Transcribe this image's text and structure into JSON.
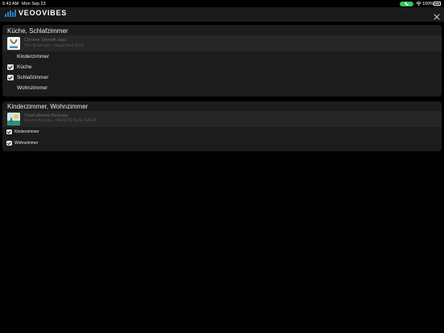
{
  "status_bar": {
    "time": "5:43 AM",
    "date": "Mon Sep 23",
    "battery_percent": "100%",
    "icons": [
      "phone-icon",
      "wifi-icon",
      "battery-icon"
    ]
  },
  "header": {
    "logo_text": "VEOOVIBES",
    "close_icon": "close-icon"
  },
  "colors": {
    "background": "#000000",
    "header": "#1a1a1a",
    "card": "#1c1c1c",
    "track_row": "#262626",
    "logo_accent": "#2d7fc4",
    "call_pill": "#34c759"
  },
  "groups": [
    {
      "title": "Küche, Schlafzimmer",
      "track": {
        "title": "Chrome Smooth Jazz",
        "artist": "Tim Bowman - Heart And Soul"
      },
      "rooms": [
        {
          "label": "Kinderzimmer",
          "checked": false
        },
        {
          "label": "Küche",
          "checked": true
        },
        {
          "label": "Schlafzimmer",
          "checked": true
        },
        {
          "label": "Wohnzimmer",
          "checked": false
        }
      ]
    },
    {
      "title": "Kinderzimmer, Wohnzimmer",
      "track": {
        "title": "Tropicalisima Bachata",
        "artist": "Hector Acosta - MENOS QUE NADA"
      },
      "rooms": [
        {
          "label": "Kinderzimmer",
          "checked": true
        },
        {
          "label": "Wohnzimmer",
          "checked": true
        }
      ]
    }
  ]
}
